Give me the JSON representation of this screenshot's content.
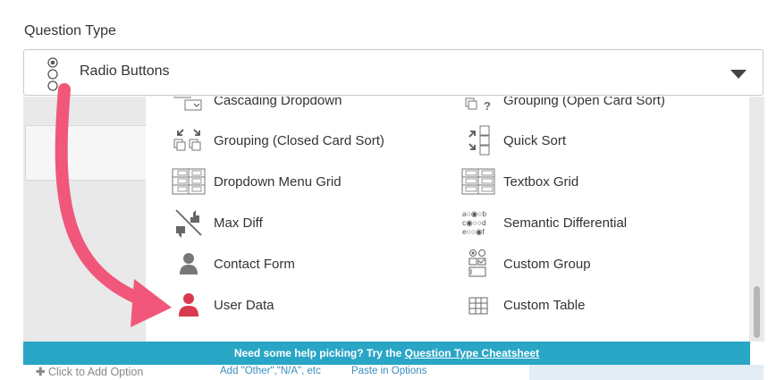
{
  "field": {
    "label": "Question Type",
    "selected_value": "Radio Buttons"
  },
  "options": [
    {
      "label": "Cascading Dropdown",
      "icon": "cascading-dropdown-icon"
    },
    {
      "label": "Grouping (Open Card Sort)",
      "icon": "grouping-open-icon"
    },
    {
      "label": "Grouping (Closed Card Sort)",
      "icon": "grouping-closed-icon"
    },
    {
      "label": "Quick Sort",
      "icon": "quick-sort-icon"
    },
    {
      "label": "Dropdown Menu Grid",
      "icon": "dropdown-grid-icon"
    },
    {
      "label": "Textbox Grid",
      "icon": "textbox-grid-icon"
    },
    {
      "label": "Max Diff",
      "icon": "max-diff-icon"
    },
    {
      "label": "Semantic Differential",
      "icon": "semantic-differential-icon"
    },
    {
      "label": "Contact Form",
      "icon": "contact-form-icon"
    },
    {
      "label": "Custom Group",
      "icon": "custom-group-icon"
    },
    {
      "label": "User Data",
      "icon": "user-data-icon"
    },
    {
      "label": "Custom Table",
      "icon": "custom-table-icon"
    }
  ],
  "semantic_icon_text": "a○◉○b\nc◉○○d\ne○○◉f",
  "help": {
    "prefix": "Need some help picking? Try the ",
    "link": "Question Type Cheatsheet"
  },
  "background": {
    "add_option": "Click to Add Option",
    "add_other": "Add \"Other\",\"N/A\", etc",
    "paste": "Paste in Options"
  },
  "colors": {
    "accent": "#29a6c6",
    "arrow": "#f0577a",
    "user_data_icon": "#d93a4d",
    "link": "#3a8fc0"
  }
}
